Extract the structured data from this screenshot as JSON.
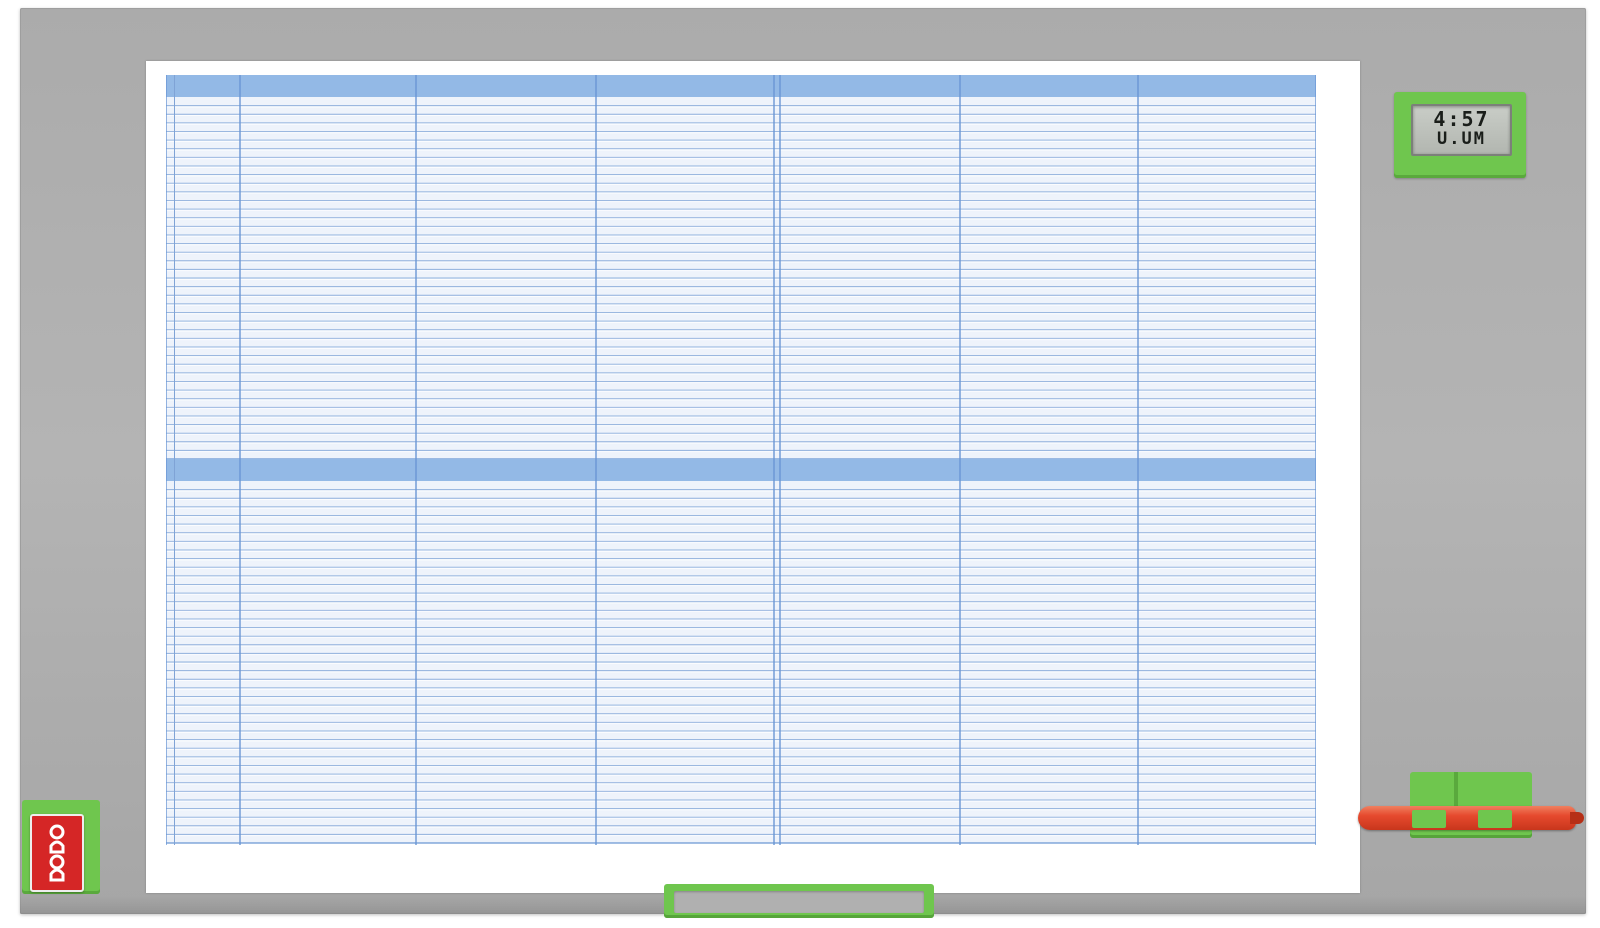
{
  "board": {
    "brand": "nobo",
    "colors": {
      "frame": "#b0b0b0",
      "accent_green": "#6fc64e",
      "logo_red": "#d52626",
      "grid_line": "#6a96d4",
      "grid_header": "#93b9e6",
      "grid_row_tint": "#eef3fb",
      "marker_red": "#e64a2e"
    }
  },
  "clock": {
    "line1": "4:57",
    "line2": "U.UM"
  },
  "planner": {
    "columns": 7,
    "sections": 2,
    "rows_per_section": 42
  },
  "icons": {
    "logo": "nobo-logo-icon",
    "clock": "digital-clock-icon",
    "marker": "marker-pen-icon",
    "handle": "tray-handle-icon"
  }
}
